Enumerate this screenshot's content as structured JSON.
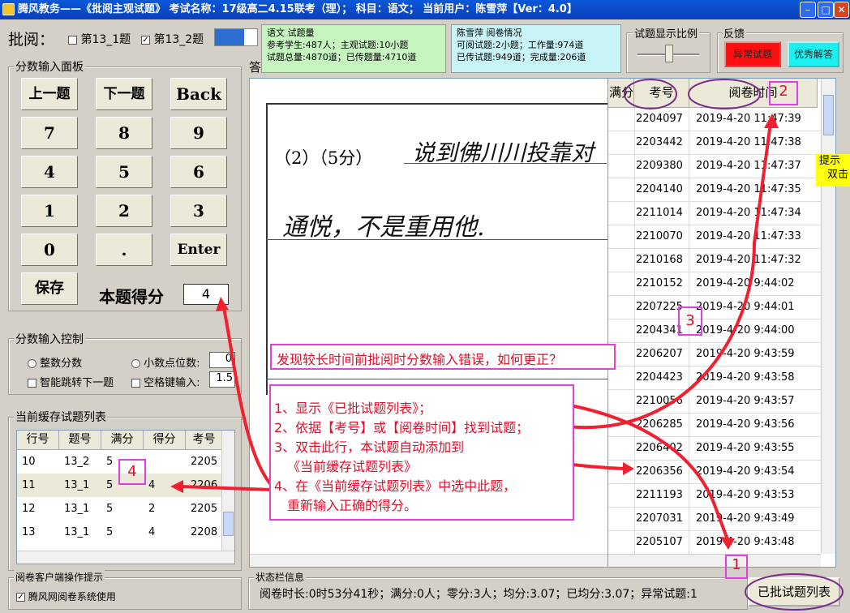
{
  "window": {
    "title": "腾风教务——《批阅主观试题》 考试名称：17级高二4.15联考（理）； 科目：语文； 当前用户：陈雪萍【Ver：4.0】"
  },
  "header": {
    "review_label": "批阅：",
    "q1_label": "第13_1题",
    "q2_label": "第13_2题"
  },
  "info1": {
    "title": "语文 试题量",
    "line1": "参考学生:487人；主观试题:10小题",
    "line2": "试题总量:4870道；已传题量:4710道"
  },
  "info2": {
    "title": "陈雪萍 阅卷情况",
    "line1": "可阅试题:2小题；工作量:974道",
    "line2": "已传试题:949道；完成量:206道"
  },
  "ratio": {
    "title": "试题显示比例"
  },
  "feedback": {
    "title": "反馈",
    "abnormal": "异常试题",
    "excellent": "优秀解答"
  },
  "score_panel": {
    "title": "分数输入面板",
    "prev": "上一题",
    "next": "下一题",
    "back": "Back",
    "k7": "7",
    "k8": "8",
    "k9": "9",
    "k4": "4",
    "k5": "5",
    "k6": "6",
    "k1": "1",
    "k2": "2",
    "k3": "3",
    "k0": "0",
    "kdot": ".",
    "enter": "Enter",
    "save": "保存",
    "score_label": "本题得分",
    "score_value": "4"
  },
  "control_panel": {
    "title": "分数输入控制",
    "integer": "整数分数",
    "decimal": "小数点位数:",
    "decimal_value": "0",
    "auto_jump": "智能跳转下一题",
    "space_key": "空格键输入:",
    "space_value": "1.5"
  },
  "cache_list": {
    "title": "当前缓存试题列表",
    "headers": [
      "行号",
      "题号",
      "满分",
      "得分",
      "考号"
    ],
    "rows": [
      [
        "10",
        "13_2",
        "5",
        "",
        "2205"
      ],
      [
        "11",
        "13_1",
        "5",
        "4",
        "2206"
      ],
      [
        "12",
        "13_1",
        "5",
        "2",
        "2205"
      ],
      [
        "13",
        "13_1",
        "5",
        "4",
        "2208"
      ]
    ]
  },
  "tips": {
    "title": "阅卷客户端操作提示",
    "system": "腾风网阅卷系统使用"
  },
  "answer_label": "答",
  "answer_sheet": {
    "question": "（2）（5分）",
    "line1": "说到佛川川投靠对",
    "line2": "通悦，不是重用他."
  },
  "graded_list": {
    "headers": [
      "满分",
      "考号",
      "阅卷时间"
    ],
    "rows": [
      [
        "2204097",
        "2019-4-20 11:47:39"
      ],
      [
        "2203442",
        "2019-4-20 11:47:38"
      ],
      [
        "2209380",
        "2019-4-20 11:47:37"
      ],
      [
        "2204140",
        "2019-4-20 11:47:35"
      ],
      [
        "2211014",
        "2019-4-20 11:47:34"
      ],
      [
        "2210070",
        "2019-4-20 11:47:33"
      ],
      [
        "2210168",
        "2019-4-20 11:47:32"
      ],
      [
        "2210152",
        "2019-4-20 9:44:02"
      ],
      [
        "2207225",
        "2019-4-20 9:44:01"
      ],
      [
        "2204341",
        "2019-4-20 9:44:00"
      ],
      [
        "2206207",
        "2019-4-20 9:43:59"
      ],
      [
        "2204423",
        "2019-4-20 9:43:58"
      ],
      [
        "2210056",
        "2019-4-20 9:43:57"
      ],
      [
        "2206285",
        "2019-4-20 9:43:56"
      ],
      [
        "2206402",
        "2019-4-20 9:43:55"
      ],
      [
        "2206356",
        "2019-4-20 9:43:54"
      ],
      [
        "2211193",
        "2019-4-20 9:43:53"
      ],
      [
        "2207031",
        "2019-4-20 9:43:49"
      ],
      [
        "2205107",
        "2019-4-20 9:43:48"
      ]
    ]
  },
  "hint_tab": {
    "line1": "提示",
    "line2": "双击"
  },
  "status": {
    "title": "状态栏信息",
    "text": "阅卷时长:0时53分41秒；满分:0人；零分:3人；均分:3.07；已均分:3.07；异常试题:1",
    "graded_button": "已批试题列表"
  },
  "annotations": {
    "question": "发现较长时间前批阅时分数输入错误，如何更正？",
    "step1": "1、显示《已批试题列表》；",
    "step2": "2、依据【考号】或【阅卷时间】找到试题；",
    "step3": "3、双击此行，本试题自动添加到",
    "step3b": "《当前缓存试题列表》",
    "step4": "4、在《当前缓存试题列表》中选中此题，",
    "step4b": "重新输入正确的得分。",
    "badge1": "1",
    "badge2": "2",
    "badge3": "3",
    "badge4": "4"
  }
}
